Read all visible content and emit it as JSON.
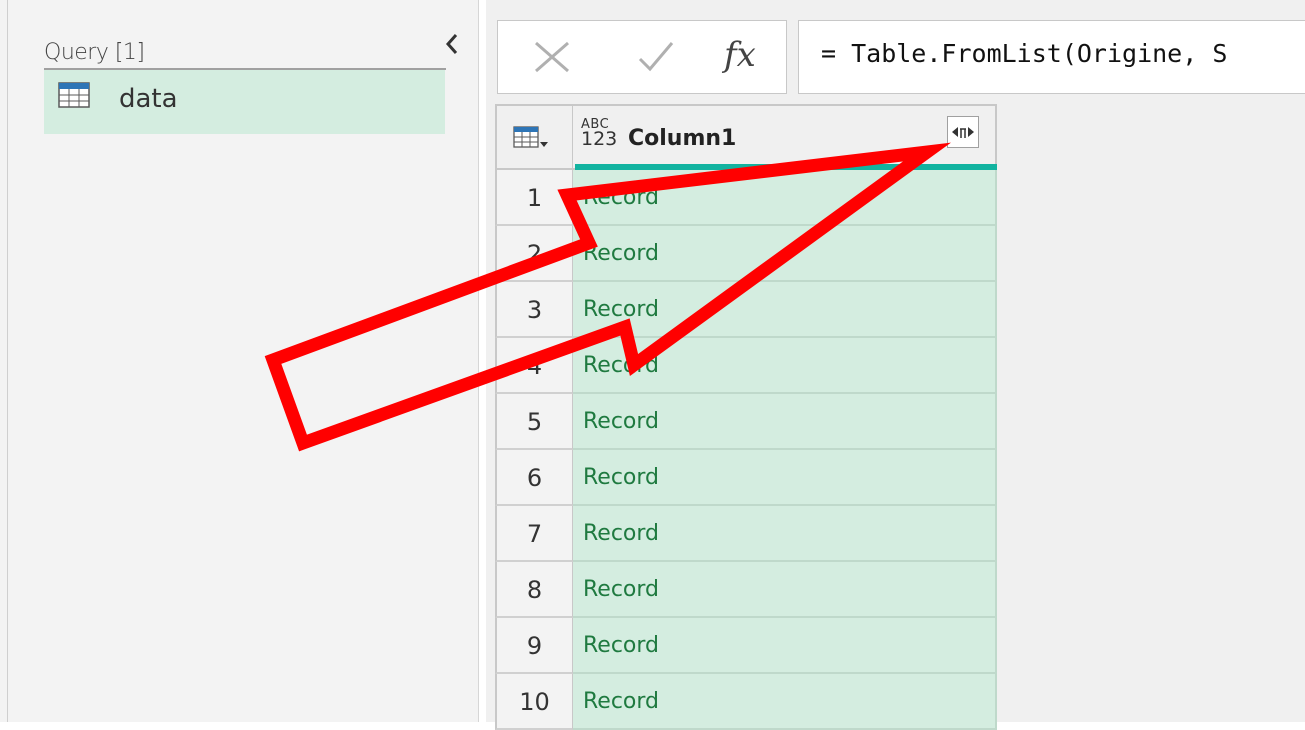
{
  "queries_pane": {
    "header": "Query [1]",
    "items": [
      {
        "label": "data",
        "icon": "table-icon"
      }
    ]
  },
  "formula_bar": {
    "cancel_icon": "close-icon",
    "confirm_icon": "check-icon",
    "fx_label": "fx",
    "formula": "= Table.FromList(Origine, S"
  },
  "grid": {
    "column_header": {
      "type_icon_top": "ABC",
      "type_icon_bottom": "123",
      "name": "Column1",
      "expand_icon": "expand-column-icon"
    },
    "rows": [
      {
        "num": "1",
        "value": "Record"
      },
      {
        "num": "2",
        "value": "Record"
      },
      {
        "num": "3",
        "value": "Record"
      },
      {
        "num": "4",
        "value": "Record"
      },
      {
        "num": "5",
        "value": "Record"
      },
      {
        "num": "6",
        "value": "Record"
      },
      {
        "num": "7",
        "value": "Record"
      },
      {
        "num": "8",
        "value": "Record"
      },
      {
        "num": "9",
        "value": "Record"
      },
      {
        "num": "10",
        "value": "Record"
      }
    ]
  },
  "colors": {
    "selected_bg": "#d4ede0",
    "record_text": "#1f7a40",
    "quality_bar": "#12b3a0",
    "annotation_arrow": "#ff0000"
  }
}
